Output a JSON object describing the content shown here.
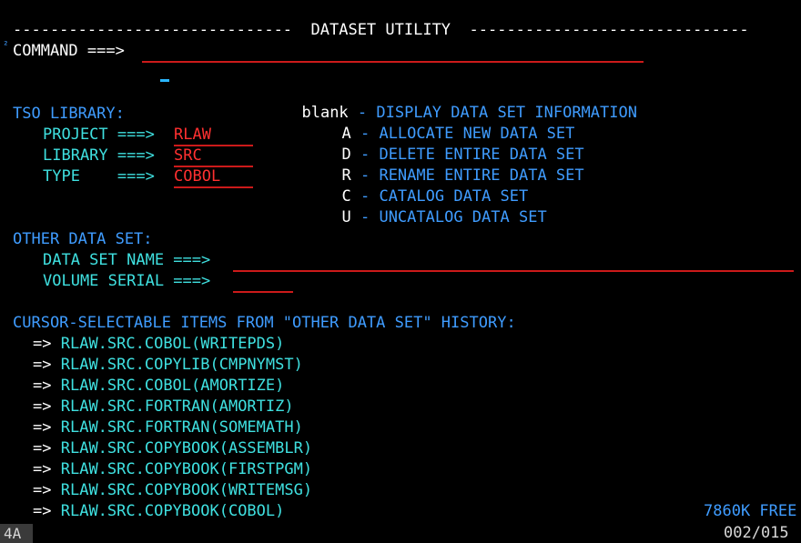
{
  "header": {
    "title_line": "------------------------------  DATASET UTILITY  ------------------------------"
  },
  "command": {
    "marker": "²",
    "label": "COMMAND ===>",
    "value": ""
  },
  "options": [
    {
      "code": "blank",
      "sep": " - ",
      "desc": "DISPLAY DATA SET INFORMATION"
    },
    {
      "code": "A",
      "sep": " - ",
      "desc": "ALLOCATE NEW DATA SET"
    },
    {
      "code": "D",
      "sep": " - ",
      "desc": "DELETE ENTIRE DATA SET"
    },
    {
      "code": "R",
      "sep": " - ",
      "desc": "RENAME ENTIRE DATA SET"
    },
    {
      "code": "C",
      "sep": " - ",
      "desc": "CATALOG DATA SET"
    },
    {
      "code": "U",
      "sep": " - ",
      "desc": "UNCATALOG DATA SET"
    }
  ],
  "tso_library": {
    "heading": "TSO LIBRARY:",
    "project_label": "PROJECT ===>",
    "project_value": "RLAW",
    "library_label": "LIBRARY ===>",
    "library_value": "SRC",
    "type_label": "TYPE    ===>",
    "type_value": "COBOL"
  },
  "other_data_set": {
    "heading": "OTHER DATA SET:",
    "dsn_label": "DATA SET NAME ===>",
    "dsn_value": "",
    "volser_label": "VOLUME SERIAL ===>",
    "volser_value": ""
  },
  "history": {
    "heading": "CURSOR-SELECTABLE ITEMS FROM \"OTHER DATA SET\" HISTORY:",
    "arrow": "=>",
    "items": [
      "RLAW.SRC.COBOL(WRITEPDS)",
      "RLAW.SRC.COPYLIB(CMPNYMST)",
      "RLAW.SRC.COBOL(AMORTIZE)",
      "RLAW.SRC.FORTRAN(AMORTIZ)",
      "RLAW.SRC.FORTRAN(SOMEMATH)",
      "RLAW.SRC.COPYBOOK(ASSEMBLR)",
      "RLAW.SRC.COPYBOOK(FIRSTPGM)",
      "RLAW.SRC.COPYBOOK(WRITEMSG)",
      "RLAW.SRC.COPYBOOK(COBOL)"
    ]
  },
  "status": {
    "free_space": "7860K FREE",
    "session_id": "4A",
    "cursor_pos": "002/015"
  }
}
